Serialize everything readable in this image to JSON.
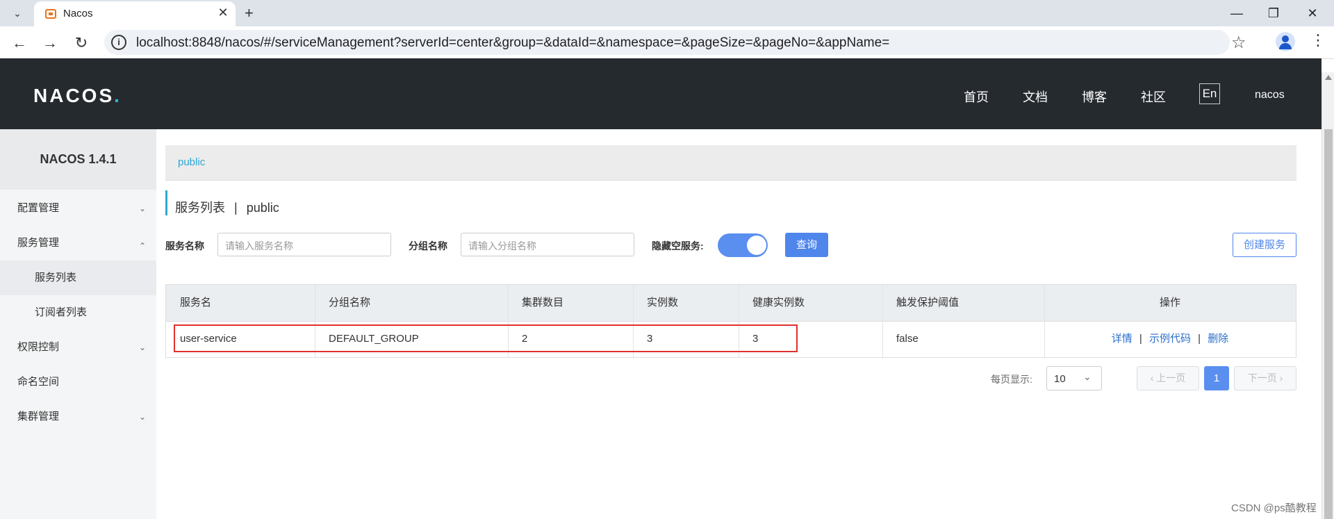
{
  "browser": {
    "tab_title": "Nacos",
    "url": "localhost:8848/nacos/#/serviceManagement?serverId=center&group=&dataId=&namespace=&pageSize=&pageNo=&appName="
  },
  "header": {
    "logo": "NACOS",
    "logo_dot": ".",
    "nav": [
      "首页",
      "文档",
      "博客",
      "社区"
    ],
    "lang": "En",
    "user": "nacos"
  },
  "sidebar": {
    "title": "NACOS 1.4.1",
    "items": [
      {
        "label": "配置管理"
      },
      {
        "label": "服务管理"
      },
      {
        "label": "服务列表"
      },
      {
        "label": "订阅者列表"
      },
      {
        "label": "权限控制"
      },
      {
        "label": "命名空间"
      },
      {
        "label": "集群管理"
      }
    ]
  },
  "content": {
    "breadcrumb": "public",
    "title": "服务列表",
    "title_sep": "|",
    "title_ns": "public",
    "filters": {
      "service_label": "服务名称",
      "service_placeholder": "请输入服务名称",
      "group_label": "分组名称",
      "group_placeholder": "请输入分组名称",
      "hide_empty_label": "隐藏空服务:",
      "hide_empty_on": true,
      "query_button": "查询",
      "create_button": "创建服务"
    },
    "table": {
      "headers": [
        "服务名",
        "分组名称",
        "集群数目",
        "实例数",
        "健康实例数",
        "触发保护阈值",
        "操作"
      ],
      "rows": [
        {
          "name": "user-service",
          "group": "DEFAULT_GROUP",
          "clusters": "2",
          "instances": "3",
          "healthy": "3",
          "threshold": "false",
          "actions": [
            "详情",
            "示例代码",
            "删除"
          ]
        }
      ],
      "action_sep": "|"
    },
    "pagination": {
      "per_page_label": "每页显示:",
      "page_size": "10",
      "prev": "上一页",
      "current": "1",
      "next": "下一页"
    }
  },
  "watermark": "CSDN @ps酷教程"
}
